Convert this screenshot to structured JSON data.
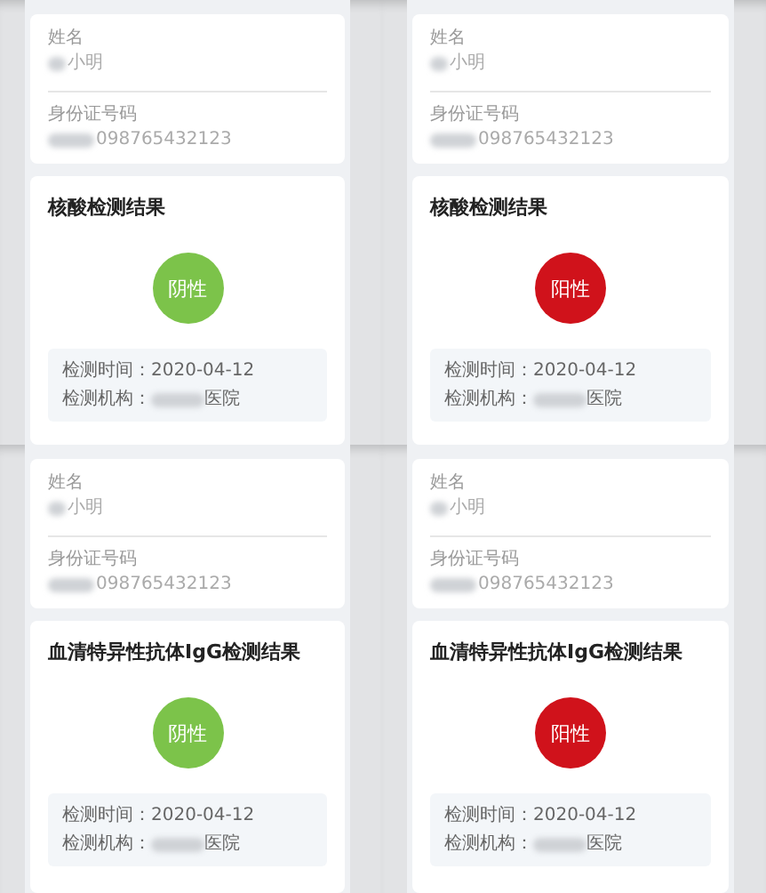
{
  "screens": [
    {
      "name_label": "姓名",
      "name": {
        "text": "小明",
        "redacted": true
      },
      "id_label": "身份证号码",
      "id_number": {
        "text": "098765432123",
        "redacted": true
      },
      "result_title": "核酸检测结果",
      "result": {
        "kind": "negative",
        "label": "阴性"
      },
      "details": [
        {
          "label": "检测时间：",
          "value": "2020-04-12",
          "redacted": false
        },
        {
          "label": "检测机构：",
          "value": "医院",
          "redacted": true
        }
      ]
    },
    {
      "name_label": "姓名",
      "name": {
        "text": "小明",
        "redacted": true
      },
      "id_label": "身份证号码",
      "id_number": {
        "text": "098765432123",
        "redacted": true
      },
      "result_title": "核酸检测结果",
      "result": {
        "kind": "positive",
        "label": "阳性"
      },
      "details": [
        {
          "label": "检测时间：",
          "value": "2020-04-12",
          "redacted": false
        },
        {
          "label": "检测机构：",
          "value": "医院",
          "redacted": true
        }
      ]
    },
    {
      "name_label": "姓名",
      "name": {
        "text": "小明",
        "redacted": true
      },
      "id_label": "身份证号码",
      "id_number": {
        "text": "098765432123",
        "redacted": true
      },
      "result_title": "血清特异性抗体IgG检测结果",
      "result": {
        "kind": "negative",
        "label": "阴性"
      },
      "details": [
        {
          "label": "检测时间：",
          "value": "2020-04-12",
          "redacted": false
        },
        {
          "label": "检测机构：",
          "value": "医院",
          "redacted": true
        }
      ]
    },
    {
      "name_label": "姓名",
      "name": {
        "text": "小明",
        "redacted": true
      },
      "id_label": "身份证号码",
      "id_number": {
        "text": "098765432123",
        "redacted": true
      },
      "result_title": "血清特异性抗体IgG检测结果",
      "result": {
        "kind": "positive",
        "label": "阳性"
      },
      "details": [
        {
          "label": "检测时间：",
          "value": "2020-04-12",
          "redacted": false
        },
        {
          "label": "检测机构：",
          "value": "医院",
          "redacted": true
        }
      ]
    }
  ]
}
